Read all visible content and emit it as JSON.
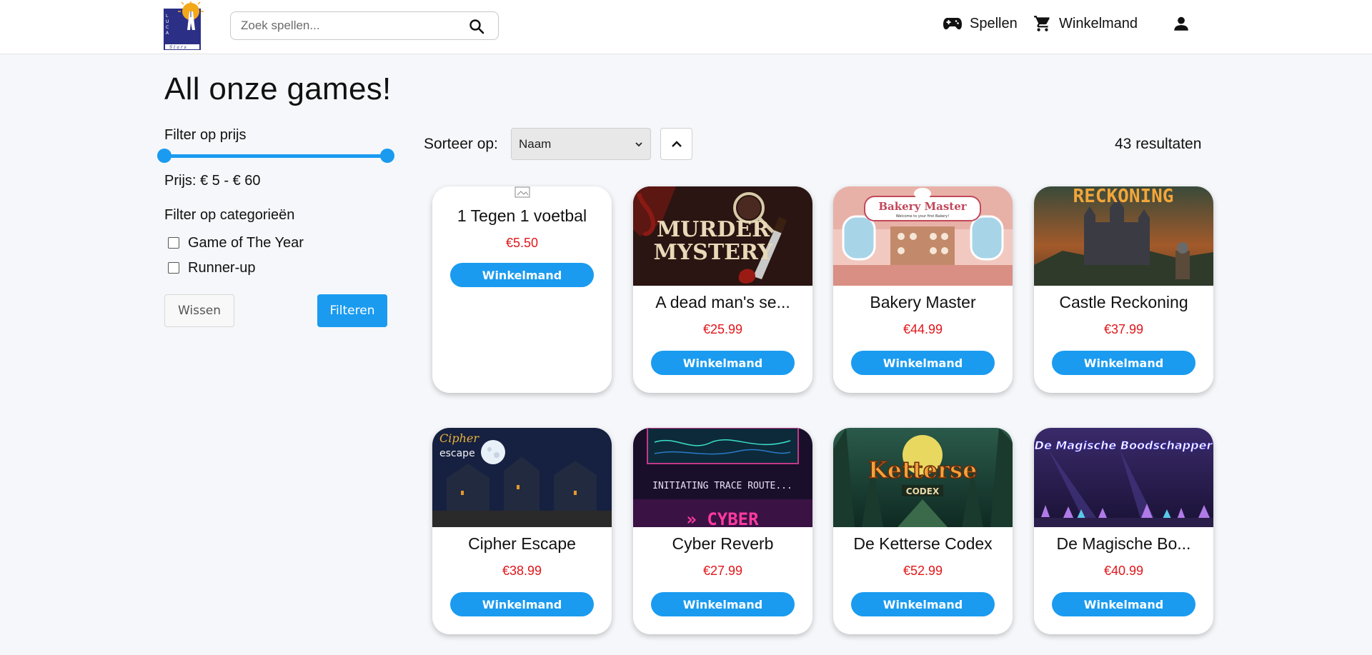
{
  "header": {
    "search_placeholder": "Zoek spellen...",
    "nav": {
      "spellen": "Spellen",
      "cart": "Winkelmand"
    }
  },
  "main": {
    "title": "All onze games!",
    "filters": {
      "price_title": "Filter op prijs",
      "price_range_text": "Prijs: € 5 - € 60",
      "price_min": 5,
      "price_max": 60,
      "category_title": "Filter op categorieën",
      "categories": [
        {
          "label": "Game of The Year",
          "checked": false
        },
        {
          "label": "Runner-up",
          "checked": false
        }
      ],
      "clear_label": "Wissen",
      "apply_label": "Filteren"
    },
    "sort": {
      "label": "Sorteer op:",
      "selected": "Naam"
    },
    "result_count": "43 resultaten",
    "cart_button_label": "Winkelmand",
    "games": [
      {
        "name": "1 Tegen 1 voetbal",
        "price": "€5.50"
      },
      {
        "name": "A dead man's se...",
        "price": "€25.99"
      },
      {
        "name": "Bakery Master",
        "price": "€44.99"
      },
      {
        "name": "Castle Reckoning",
        "price": "€37.99"
      },
      {
        "name": "Cipher Escape",
        "price": "€38.99"
      },
      {
        "name": "Cyber Reverb",
        "price": "€27.99"
      },
      {
        "name": "De Ketterse Codex",
        "price": "€52.99"
      },
      {
        "name": "De Magische Bo...",
        "price": "€40.99"
      }
    ],
    "thumb_text": {
      "murder": "MURDER",
      "mystery": "MYSTERY",
      "bakery_title": "Bakery Master",
      "bakery_sub": "Welcome to your first Bakery!",
      "reckoning": "RECKONING",
      "cipher": "Cipher",
      "escape": "escape",
      "trace": "INITIATING TRACE ROUTE...",
      "cyber": "» CYBER",
      "ketterse": "Ketterse",
      "codex": "CODEX",
      "magische": "De Magische Boodschapper"
    }
  },
  "colors": {
    "accent": "#1a9bf0",
    "price": "#e0161b",
    "background": "#f5f7fa"
  }
}
